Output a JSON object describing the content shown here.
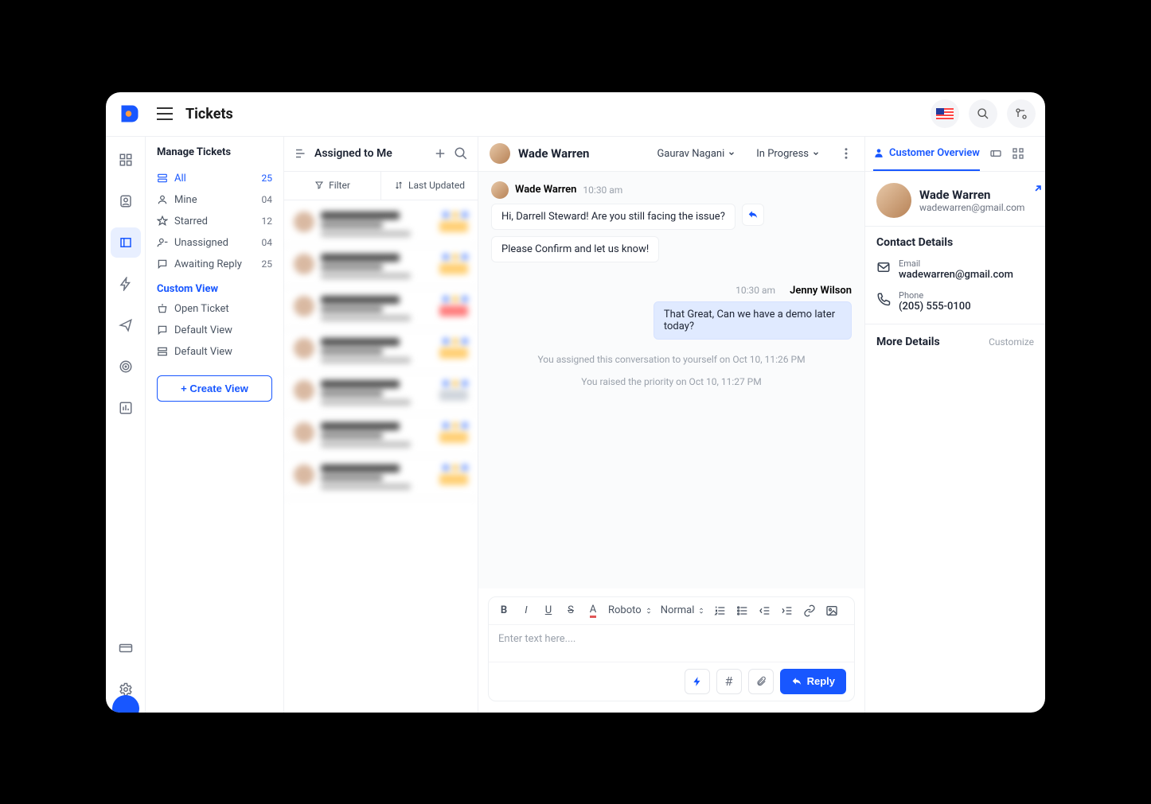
{
  "title": "Tickets",
  "manage": {
    "header": "Manage Tickets",
    "items": [
      {
        "label": "All",
        "count": "25"
      },
      {
        "label": "Mine",
        "count": "04"
      },
      {
        "label": "Starred",
        "count": "12"
      },
      {
        "label": "Unassigned",
        "count": "04"
      },
      {
        "label": "Awaiting Reply",
        "count": "25"
      }
    ],
    "custom_view": "Custom View",
    "custom_items": [
      {
        "label": "Open Ticket"
      },
      {
        "label": "Default View"
      },
      {
        "label": "Default View"
      }
    ],
    "create_view": "+ Create View"
  },
  "list": {
    "header": "Assigned to Me",
    "filter": "Filter",
    "last_updated": "Last Updated"
  },
  "conv": {
    "customer": "Wade Warren",
    "assignee": "Gaurav Nagani",
    "status": "In Progress",
    "thread": {
      "left_name": "Wade Warren",
      "left_time": "10:30 am",
      "left_msgs": [
        "Hi, Darrell Steward! Are you still facing the issue?",
        "Please Confirm and let us know!"
      ],
      "right_time": "10:30 am",
      "right_name": "Jenny Wilson",
      "right_msg": "That Great, Can we have a demo later today?"
    },
    "sys1": "You assigned this conversation to yourself on Oct 10, 11:26 PM",
    "sys2": "You raised the priority on Oct 10, 11:27 PM"
  },
  "composer": {
    "font": "Roboto",
    "size": "Normal",
    "placeholder": "Enter text here....",
    "reply": "Reply"
  },
  "details": {
    "tab_overview": "Customer Overview",
    "name": "Wade Warren",
    "email_short": "wadewarren@gmail.com",
    "contact_header": "Contact Details",
    "email_label": "Email",
    "email_value": "wadewarren@gmail.com",
    "phone_label": "Phone",
    "phone_value": "(205) 555-0100",
    "more": "More Details",
    "customize": "Customize"
  }
}
